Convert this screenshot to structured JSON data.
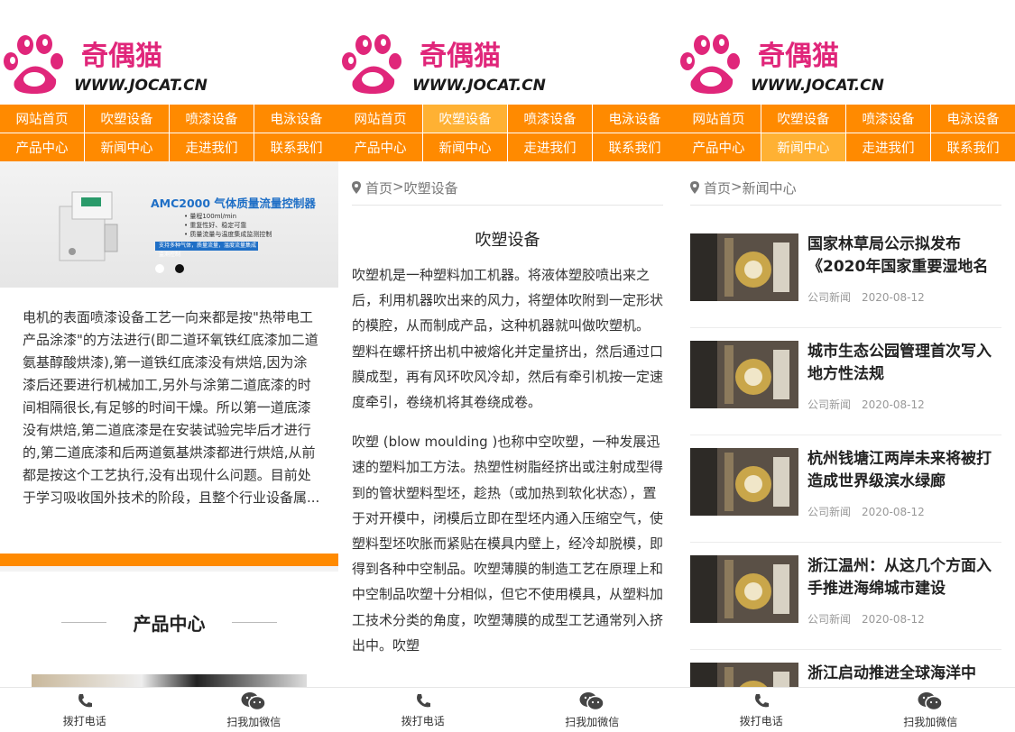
{
  "logo": {
    "brand_text": "奇偶猫",
    "url_text": "WWW.JOCAT.CN"
  },
  "nav": {
    "items": [
      "网站首页",
      "吹塑设备",
      "喷漆设备",
      "电泳设备",
      "产品中心",
      "新闻中心",
      "走进我们",
      "联系我们"
    ]
  },
  "bottombar": {
    "call": "拨打电话",
    "wechat": "扫我加微信"
  },
  "home": {
    "banner": {
      "title": "AMC2000 气体质量流量控制器",
      "bullets": [
        "• 量程100ml/min",
        "• 重复性好、稳定可靠",
        "• 质量流量与温度集成监测控制"
      ],
      "tag": "支持多种气体，质量流量，温度流量集成监测控制"
    },
    "intro": "电机的表面喷漆设备工艺一向来都是按\"热带电工产品涂漆\"的方法进行(即二道环氧铁红底漆加二道氨基醇酸烘漆),第一道铁红底漆没有烘焙,因为涂漆后还要进行机械加工,另外与涂第二道底漆的时间相隔很长,有足够的时间干燥。所以第一道底漆没有烘焙,第二道底漆是在安装试验完毕后才进行的,第二道底漆和后两道氨基烘漆都进行烘焙,从前都是按这个工艺执行,没有出现什么问题。目前处于学习吸收国外技术的阶段，且整个行业设备属...",
    "section_title": "产品中心"
  },
  "article": {
    "crumb_home": "首页",
    "crumb_sep": ">",
    "crumb_current": "吹塑设备",
    "title": "吹塑设备",
    "paragraphs": [
      "吹塑机是一种塑料加工机器。将液体塑胶喷出来之后，利用机器吹出来的风力，将塑体吹附到一定形状的模腔，从而制成产品，这种机器就叫做吹塑机。 塑料在螺杆挤出机中被熔化并定量挤出，然后通过口膜成型，再有风环吹风冷却，然后有牵引机按一定速度牵引，卷绕机将其卷绕成卷。",
      "吹塑 (blow moulding )也称中空吹塑，一种发展迅速的塑料加工方法。热塑性树脂经挤出或注射成型得到的管状塑料型坯，趁热（或加热到软化状态），置于对开模中，闭模后立即在型坯内通入压缩空气，使塑料型坯吹胀而紧贴在模具内壁上，经冷却脱模，即得到各种中空制品。吹塑薄膜的制造工艺在原理上和中空制品吹塑十分相似，但它不使用模具，从塑料加工技术分类的角度，吹塑薄膜的成型工艺通常列入挤出中。吹塑"
    ]
  },
  "news": {
    "crumb_home": "首页",
    "crumb_sep": ">",
    "crumb_current": "新闻中心",
    "items": [
      {
        "title": "国家林草局公示拟发布《2020年国家重要湿地名录》",
        "category": "公司新闻",
        "date": "2020-08-12"
      },
      {
        "title": "城市生态公园管理首次写入地方性法规",
        "category": "公司新闻",
        "date": "2020-08-12"
      },
      {
        "title": "杭州钱塘江两岸未来将被打造成世界级滨水绿廊",
        "category": "公司新闻",
        "date": "2020-08-12"
      },
      {
        "title": "浙江温州：从这几个方面入手推进海绵城市建设",
        "category": "公司新闻",
        "date": "2020-08-12"
      },
      {
        "title": "浙江启动推进全球海洋中",
        "category": "",
        "date": ""
      }
    ]
  },
  "colors": {
    "accent": "#ff8a00",
    "accent_active": "#ffb133",
    "logo_pink": "#e0267a"
  }
}
